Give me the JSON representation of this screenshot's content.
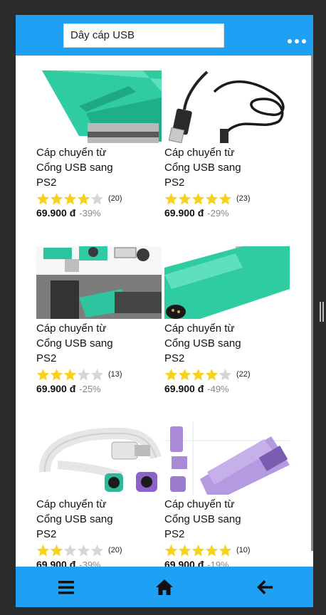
{
  "search": {
    "query": "Dây cáp USB"
  },
  "products": [
    {
      "title": "Cáp chuyển từ Cổng USB sang PS2",
      "rating": 4,
      "reviews": "(20)",
      "price": "69.900 đ",
      "discount": "-39%"
    },
    {
      "title": "Cáp chuyển từ Cổng USB sang PS2",
      "rating": 5,
      "reviews": "(23)",
      "price": "69.900 đ",
      "discount": "-29%"
    },
    {
      "title": "Cáp chuyển từ Cổng USB sang PS2",
      "rating": 3,
      "reviews": "(13)",
      "price": "69.900 đ",
      "discount": "-25%"
    },
    {
      "title": "Cáp chuyển từ Cổng USB sang PS2",
      "rating": 4,
      "reviews": "(22)",
      "price": "69.900 đ",
      "discount": "-49%"
    },
    {
      "title": "Cáp chuyển từ Cổng USB sang PS2",
      "rating": 2,
      "reviews": "(20)",
      "price": "69.900 đ",
      "discount": "-39%"
    },
    {
      "title": "Cáp chuyển từ Cổng USB sang PS2",
      "rating": 5,
      "reviews": "(10)",
      "price": "69.900 đ",
      "discount": "-19%"
    }
  ],
  "icons": {
    "more": "more-dots-icon",
    "menu": "hamburger-menu-icon",
    "home": "home-icon",
    "back": "back-arrow-icon",
    "star": "star-icon"
  },
  "colors": {
    "brand": "#1ea0f4",
    "star_filled": "#f7d21c",
    "star_empty": "#d6d6d6"
  }
}
